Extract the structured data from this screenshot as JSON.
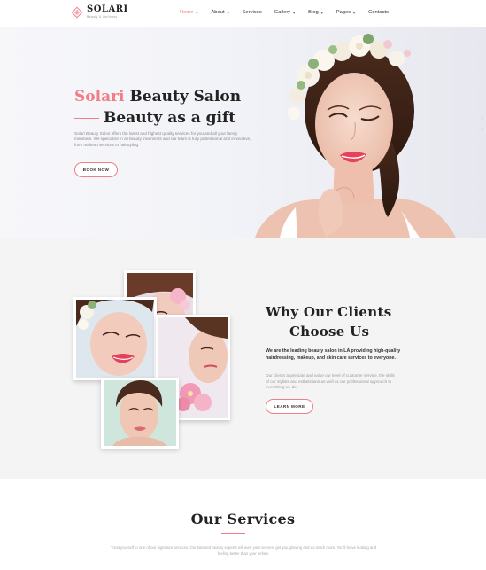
{
  "header": {
    "logo_name": "SOLARI",
    "logo_tagline": "Beauty & Wellness",
    "nav": [
      {
        "label": "Home",
        "dropdown": true,
        "active": true
      },
      {
        "label": "About",
        "dropdown": true,
        "active": false
      },
      {
        "label": "Services",
        "dropdown": false,
        "active": false
      },
      {
        "label": "Gallery",
        "dropdown": true,
        "active": false
      },
      {
        "label": "Blog",
        "dropdown": true,
        "active": false
      },
      {
        "label": "Pages",
        "dropdown": true,
        "active": false
      },
      {
        "label": "Contacts",
        "dropdown": false,
        "active": false
      }
    ]
  },
  "hero": {
    "title_accent": "Solari",
    "title_rest": "Beauty Salon",
    "subtitle": "Beauty as a gift",
    "description": "Solari Beauty Salon offers the latest and highest quality services for you and all your family members. We specialize in all beauty treatments and our team is fully professional and innovative, from makeup services to hairstyling.",
    "button_label": "BOOK NOW",
    "slider_arrows": [
      "›",
      "‹"
    ]
  },
  "why_us": {
    "title_line1": "Why Our Clients",
    "title_line2": "Choose Us",
    "lead": "We are the leading beauty salon in LA providing high-quality hairdressing, makeup, and skin care services to everyone.",
    "description": "Our clients appreciate and value our level of customer service, the skills of our stylists and estheticians as well as our professional approach to everything we do.",
    "button_label": "LEARN MORE"
  },
  "services": {
    "title": "Our Services",
    "description": "Treat yourself to one of our signature services. Our talented beauty experts will wow your senses, get you glowing and do much more. You'll leave looking and feeling better than your before."
  },
  "colors": {
    "accent": "#f27d86",
    "text_dark": "#222222",
    "text_muted": "#8a8a8a",
    "section_bg": "#f4f4f5"
  }
}
